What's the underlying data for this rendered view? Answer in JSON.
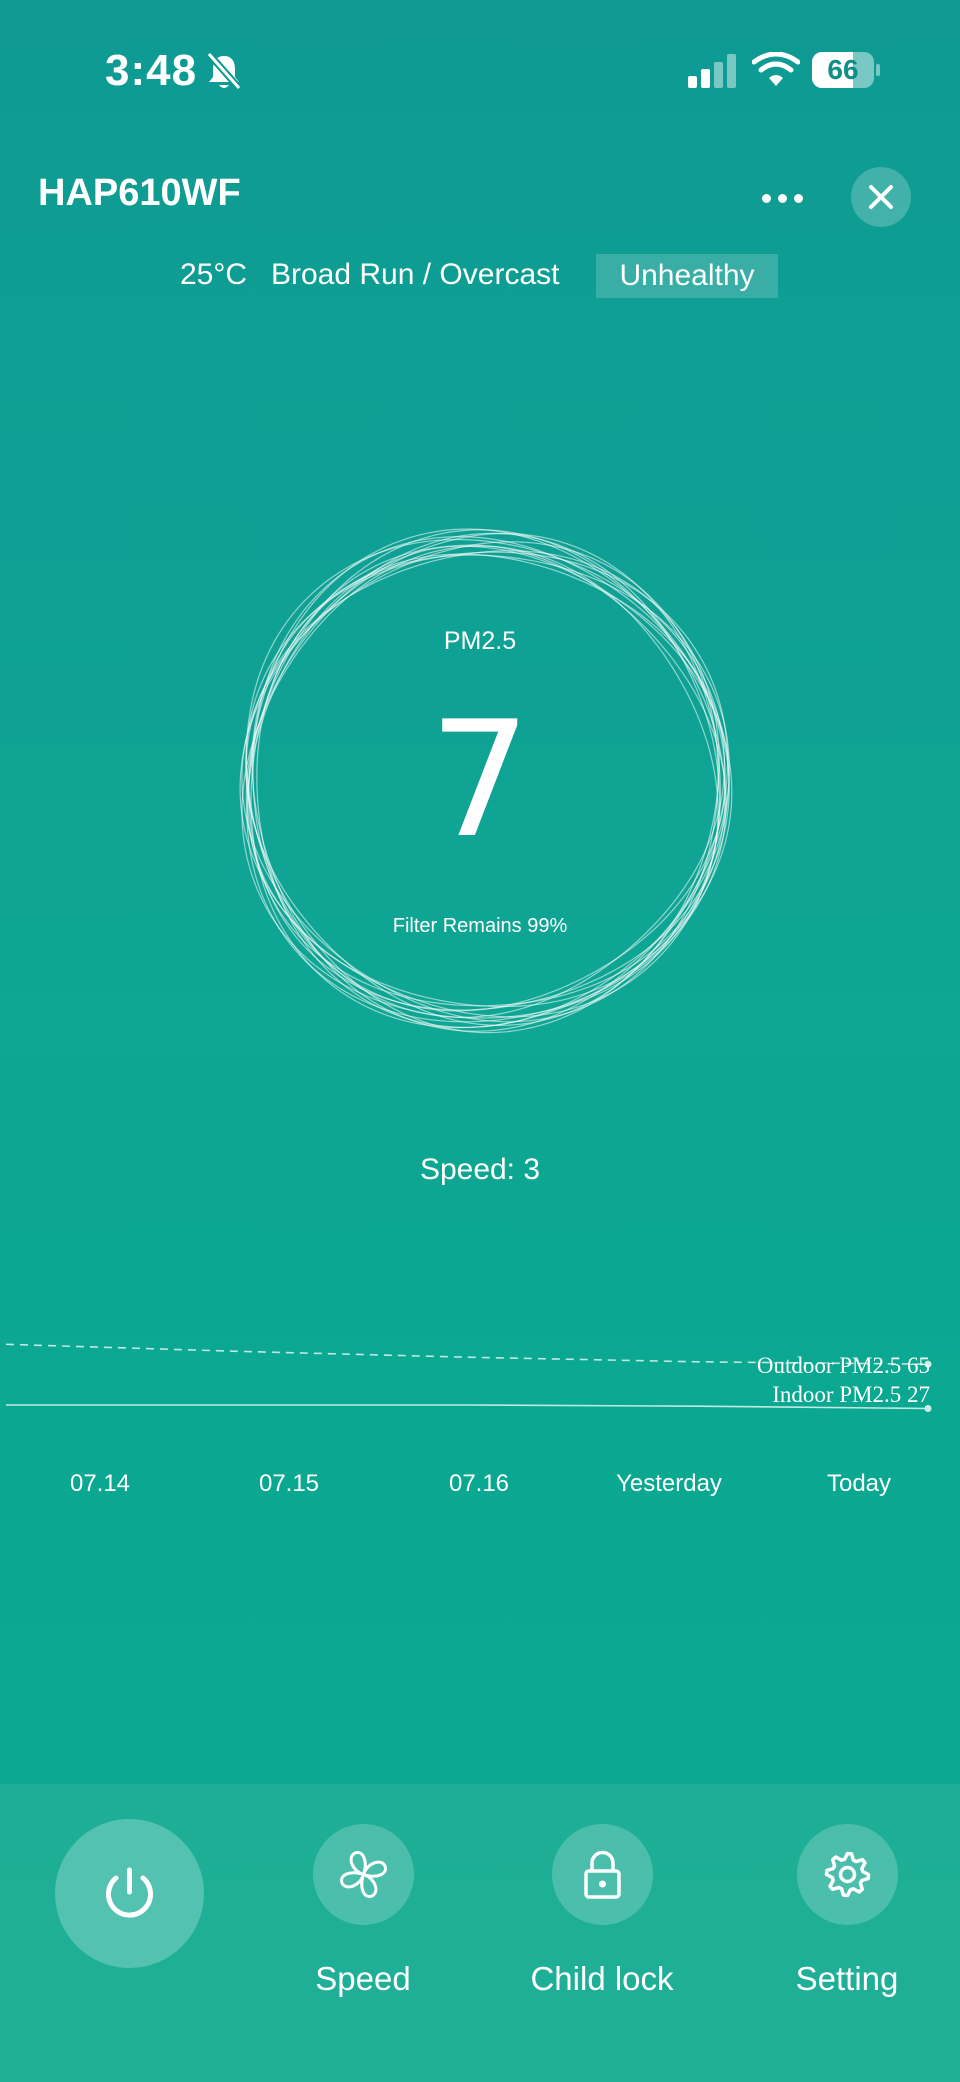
{
  "status_bar": {
    "time": "3:48",
    "battery_level": "66",
    "icons": [
      "bell-slash-icon",
      "cellular-signal-icon",
      "wifi-icon",
      "battery-icon"
    ]
  },
  "header": {
    "device_name": "HAP610WF",
    "more_icon": "ellipsis-icon",
    "close_icon": "close-icon"
  },
  "weather": {
    "temperature": "25°C",
    "location_condition": "Broad Run / Overcast",
    "air_quality": "Unhealthy"
  },
  "gauge": {
    "label": "PM2.5",
    "value": "7",
    "filter_text": "Filter Remains 99%"
  },
  "speed": {
    "text": "Speed: 3"
  },
  "history": {
    "x_labels": [
      "07.14",
      "07.15",
      "07.16",
      "Yesterday",
      "Today"
    ],
    "outdoor_label": "Outdoor PM2.5 65",
    "indoor_label": "Indoor PM2.5 27"
  },
  "chart_data": {
    "type": "line",
    "categories": [
      "07.14",
      "07.15",
      "07.16",
      "Yesterday",
      "Today"
    ],
    "series": [
      {
        "name": "Outdoor PM2.5",
        "style": "dashed",
        "values": [
          82,
          76,
          71,
          67,
          65
        ]
      },
      {
        "name": "Indoor PM2.5",
        "style": "solid",
        "values": [
          30,
          30,
          30,
          29,
          27
        ]
      }
    ],
    "ylim": [
      0,
      120
    ],
    "grid": false,
    "legend": "end-of-line labels"
  },
  "controls": {
    "power_icon": "power-icon",
    "speed_label": "Speed",
    "speed_icon": "fan-icon",
    "child_lock_label": "Child lock",
    "child_lock_icon": "lock-icon",
    "setting_label": "Setting",
    "setting_icon": "gear-icon"
  },
  "colors": {
    "background_top": "#0e9a93",
    "background_bottom": "#0fa98f",
    "text": "#ffffff"
  }
}
